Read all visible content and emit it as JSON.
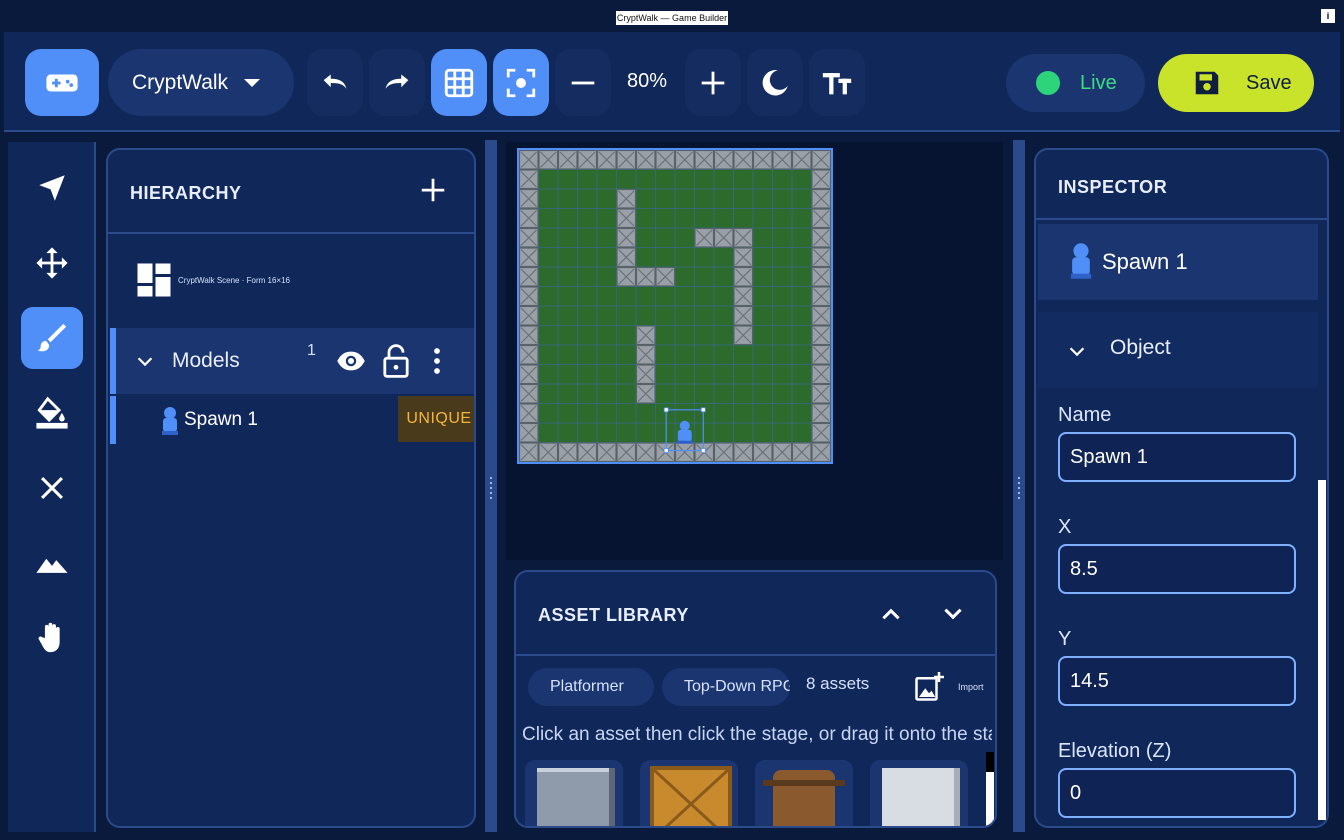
{
  "window": {
    "title": "CryptWalk — Game Builder",
    "info_icon": "i"
  },
  "toolbar": {
    "app_icon": "gamepad-icon",
    "project": "CryptWalk",
    "zoom": "80%",
    "live_label": "Live",
    "save_label": "Save",
    "colors": {
      "accent": "#4f8ff7",
      "live": "#2ed47a",
      "save": "#c9e22a",
      "bg": "#10275a"
    }
  },
  "tools": [
    "navigate-icon",
    "move-icon",
    "brush-icon",
    "fill-icon",
    "erase-icon",
    "terrain-icon",
    "hand-icon"
  ],
  "hierarchy": {
    "title": "HIERARCHY",
    "scene_label": "CryptWalk Scene · Form 16×16",
    "group": {
      "label": "Models",
      "count": "1"
    },
    "item": {
      "label": "Spawn 1",
      "badge": "UNIQUE"
    }
  },
  "stage": {
    "grid_size": 16,
    "walls": [
      [
        0,
        0
      ],
      [
        1,
        0
      ],
      [
        2,
        0
      ],
      [
        3,
        0
      ],
      [
        4,
        0
      ],
      [
        5,
        0
      ],
      [
        6,
        0
      ],
      [
        7,
        0
      ],
      [
        8,
        0
      ],
      [
        9,
        0
      ],
      [
        10,
        0
      ],
      [
        11,
        0
      ],
      [
        12,
        0
      ],
      [
        13,
        0
      ],
      [
        14,
        0
      ],
      [
        15,
        0
      ],
      [
        0,
        1
      ],
      [
        15,
        1
      ],
      [
        0,
        2
      ],
      [
        15,
        2
      ],
      [
        0,
        3
      ],
      [
        15,
        3
      ],
      [
        0,
        4
      ],
      [
        15,
        4
      ],
      [
        0,
        5
      ],
      [
        15,
        5
      ],
      [
        0,
        6
      ],
      [
        15,
        6
      ],
      [
        0,
        7
      ],
      [
        15,
        7
      ],
      [
        0,
        8
      ],
      [
        15,
        8
      ],
      [
        0,
        9
      ],
      [
        15,
        9
      ],
      [
        0,
        10
      ],
      [
        15,
        10
      ],
      [
        0,
        11
      ],
      [
        15,
        11
      ],
      [
        0,
        12
      ],
      [
        15,
        12
      ],
      [
        0,
        13
      ],
      [
        15,
        13
      ],
      [
        0,
        14
      ],
      [
        15,
        14
      ],
      [
        0,
        15
      ],
      [
        1,
        15
      ],
      [
        2,
        15
      ],
      [
        3,
        15
      ],
      [
        4,
        15
      ],
      [
        5,
        15
      ],
      [
        6,
        15
      ],
      [
        7,
        15
      ],
      [
        8,
        15
      ],
      [
        9,
        15
      ],
      [
        10,
        15
      ],
      [
        11,
        15
      ],
      [
        12,
        15
      ],
      [
        13,
        15
      ],
      [
        14,
        15
      ],
      [
        15,
        15
      ],
      [
        5,
        2
      ],
      [
        5,
        3
      ],
      [
        5,
        4
      ],
      [
        5,
        5
      ],
      [
        5,
        6
      ],
      [
        6,
        6
      ],
      [
        7,
        6
      ],
      [
        9,
        4
      ],
      [
        10,
        4
      ],
      [
        11,
        4
      ],
      [
        11,
        5
      ],
      [
        11,
        6
      ],
      [
        11,
        7
      ],
      [
        11,
        8
      ],
      [
        11,
        9
      ],
      [
        6,
        9
      ],
      [
        6,
        10
      ],
      [
        6,
        11
      ],
      [
        6,
        12
      ]
    ],
    "spawn": [
      8.5,
      14.5
    ]
  },
  "asset_library": {
    "title": "ASSET LIBRARY",
    "categories": [
      "Platformer",
      "Top-Down RPG"
    ],
    "count": "8 assets",
    "import_label": "Import",
    "hint": "Click an asset then click the stage, or drag it onto the stage."
  },
  "inspector": {
    "title": "INSPECTOR",
    "selected": "Spawn 1",
    "section": "Object",
    "fields": [
      {
        "label": "Name",
        "value": "Spawn 1"
      },
      {
        "label": "X",
        "value": "8.5"
      },
      {
        "label": "Y",
        "value": "14.5"
      },
      {
        "label": "Elevation (Z)",
        "value": "0"
      }
    ]
  }
}
